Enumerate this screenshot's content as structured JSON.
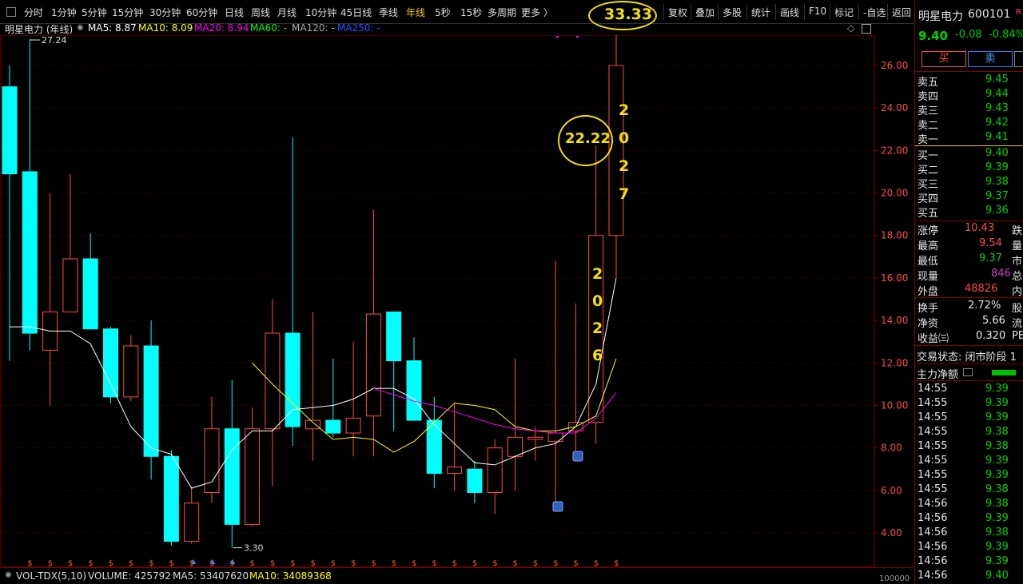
{
  "toolbar": {
    "periods": [
      "分时",
      "1分钟",
      "5分钟",
      "15分钟",
      "30分钟",
      "60分钟",
      "日线",
      "周线",
      "月线",
      "10分钟",
      "45日线",
      "季线",
      "年线",
      "5秒",
      "15秒",
      "多周期",
      "更多 〉"
    ],
    "active_period": "年线",
    "tools": [
      "复权",
      "叠加",
      "多股",
      "统计",
      "画线",
      "F10",
      "标记",
      "-自选",
      "返回"
    ]
  },
  "chart_header": {
    "stock_label": "明星电力 (年线)",
    "ma5": "MA5: 8.87",
    "ma10": "MA10: 8.09",
    "ma20": "MA20: 8.94",
    "ma60": "MA60: -",
    "ma120": "MA120: -",
    "ma250": "MA250: -"
  },
  "colors": {
    "up": "#ff4a4a",
    "down": "#00ffff",
    "ma5": "#ffffff",
    "ma10": "#ffff00",
    "ma20": "#ff00ff",
    "ma60": "#00ff00",
    "ma120": "#aaaaaa",
    "ma250": "#3050ff",
    "annotation": "#f5e100"
  },
  "chart_data": {
    "type": "candlestick",
    "title": "明星电力 (年线)",
    "ylim": [
      3,
      28.5
    ],
    "y_ticks": [
      "26.00",
      "24.00",
      "22.00",
      "20.00",
      "18.00",
      "16.00",
      "14.00",
      "12.00",
      "10.00",
      "8.00",
      "6.00",
      "4.00"
    ],
    "y_tick_values": [
      26,
      24,
      22,
      20,
      18,
      16,
      14,
      12,
      10,
      8,
      6,
      4
    ],
    "annotations": {
      "max_label": "27.24",
      "min_label": "3.30"
    },
    "candles": [
      {
        "o": 25.0,
        "h": 26.0,
        "l": 12.1,
        "c": 20.9
      },
      {
        "o": 21.0,
        "h": 27.24,
        "l": 12.6,
        "c": 13.4
      },
      {
        "o": 12.6,
        "h": 20.0,
        "l": 10.0,
        "c": 14.4
      },
      {
        "o": 14.4,
        "h": 20.9,
        "l": 14.4,
        "c": 16.9
      },
      {
        "o": 16.9,
        "h": 18.1,
        "l": 13.7,
        "c": 13.6
      },
      {
        "o": 13.6,
        "h": 13.7,
        "l": 10.1,
        "c": 10.4
      },
      {
        "o": 10.4,
        "h": 13.3,
        "l": 10.2,
        "c": 12.8
      },
      {
        "o": 12.8,
        "h": 14.0,
        "l": 6.5,
        "c": 7.6
      },
      {
        "o": 7.6,
        "h": 7.9,
        "l": 3.4,
        "c": 3.6
      },
      {
        "o": 3.6,
        "h": 6.2,
        "l": 3.5,
        "c": 5.4
      },
      {
        "o": 5.9,
        "h": 10.4,
        "l": 5.4,
        "c": 8.9
      },
      {
        "o": 8.9,
        "h": 11.2,
        "l": 3.3,
        "c": 4.4
      },
      {
        "o": 4.4,
        "h": 9.9,
        "l": 4.3,
        "c": 8.9
      },
      {
        "o": 8.9,
        "h": 15.0,
        "l": 6.2,
        "c": 13.4
      },
      {
        "o": 13.4,
        "h": 22.6,
        "l": 8.1,
        "c": 9.0
      },
      {
        "o": 8.9,
        "h": 14.4,
        "l": 7.4,
        "c": 9.3
      },
      {
        "o": 9.3,
        "h": 12.2,
        "l": 8.5,
        "c": 8.7
      },
      {
        "o": 8.7,
        "h": 13.0,
        "l": 7.6,
        "c": 9.4
      },
      {
        "o": 9.5,
        "h": 19.2,
        "l": 7.6,
        "c": 14.3
      },
      {
        "o": 14.4,
        "h": 14.4,
        "l": 8.8,
        "c": 12.1
      },
      {
        "o": 12.1,
        "h": 13.2,
        "l": 9.8,
        "c": 9.3
      },
      {
        "o": 9.3,
        "h": 10.4,
        "l": 6.1,
        "c": 6.8
      },
      {
        "o": 6.8,
        "h": 10.1,
        "l": 6.0,
        "c": 7.1
      },
      {
        "o": 7.0,
        "h": 7.4,
        "l": 5.4,
        "c": 5.9
      },
      {
        "o": 5.9,
        "h": 8.4,
        "l": 4.9,
        "c": 8.0
      },
      {
        "o": 7.6,
        "h": 12.2,
        "l": 6.0,
        "c": 8.5
      },
      {
        "o": 8.4,
        "h": 9.0,
        "l": 7.4,
        "c": 8.5
      },
      {
        "o": 8.3,
        "h": 16.8,
        "l": 5.4,
        "c": 8.7
      },
      {
        "o": 8.8,
        "h": 14.8,
        "l": 7.7,
        "c": 9.2
      },
      {
        "o": 9.2,
        "h": 22.22,
        "l": 8.2,
        "c": 18.0
      },
      {
        "o": 18.0,
        "h": 33.33,
        "l": 16.0,
        "c": 26.0
      }
    ],
    "ma5_values": [
      13.7,
      13.7,
      13.5,
      13.5,
      12.9,
      11.0,
      9.0,
      8.0,
      7.7,
      6.1,
      6.4,
      7.9,
      8.8,
      8.8,
      9.8,
      9.9,
      10.0,
      10.3,
      10.8,
      10.8,
      10.3,
      9.1,
      8.2,
      7.3,
      7.2,
      7.6,
      8.0,
      8.2,
      9.0,
      11.0,
      16.0
    ],
    "ma10_values": [
      12.0,
      11.0,
      10.1,
      9.2,
      8.4,
      8.5,
      8.4,
      7.8,
      8.3,
      9.2,
      10.1,
      10.0,
      9.8,
      9.0,
      8.8,
      8.8,
      9.0,
      9.5,
      12.2
    ],
    "ma20_values": [
      10.8,
      10.5,
      10.2,
      10.0,
      9.7,
      9.4,
      9.1,
      8.9,
      8.8,
      8.7,
      8.7,
      9.4,
      10.6
    ],
    "overlays": {
      "year_2026_label": [
        "2",
        "0",
        "2",
        "6"
      ],
      "year_2027_label": [
        "2",
        "0",
        "2",
        "7"
      ],
      "circle_22": "22.22",
      "circle_33": "33.33"
    }
  },
  "volume_bar": {
    "label": "VOL-TDX(5,10)",
    "volume": "VOLUME: 425792",
    "ma5": "MA5: 53407620",
    "ma10": "MA10: 34089368",
    "axis_label": "100000"
  },
  "quote": {
    "name": "明星电力",
    "code": "600101",
    "flag": "R",
    "price": "9.40",
    "change": "-0.08",
    "change_pct": "-0.84%",
    "buy_btn": "买",
    "sell_btn": "卖",
    "asks": [
      {
        "label": "卖五",
        "price": "9.45"
      },
      {
        "label": "卖四",
        "price": "9.44"
      },
      {
        "label": "卖三",
        "price": "9.43"
      },
      {
        "label": "卖二",
        "price": "9.42"
      },
      {
        "label": "卖一",
        "price": "9.41"
      }
    ],
    "bids": [
      {
        "label": "买一",
        "price": "9.40"
      },
      {
        "label": "买二",
        "price": "9.39"
      },
      {
        "label": "买三",
        "price": "9.38"
      },
      {
        "label": "买四",
        "price": "9.37"
      },
      {
        "label": "买五",
        "price": "9.36"
      }
    ],
    "stats": [
      {
        "label": "涨停",
        "value": "10.43",
        "tail": "跌"
      },
      {
        "label": "最高",
        "value": "9.54",
        "tail": "量"
      },
      {
        "label": "最低",
        "value": "9.37",
        "tail": "市"
      },
      {
        "label": "现量",
        "value": "846",
        "tail": "总"
      },
      {
        "label": "外盘",
        "value": "48826",
        "tail": "内"
      }
    ],
    "stats2": [
      {
        "label": "换手",
        "value": "2.72%",
        "tail": "股"
      },
      {
        "label": "净资",
        "value": "5.66",
        "tail": "流"
      },
      {
        "label": "收益㈢",
        "value": "0.320",
        "tail": "PE"
      }
    ],
    "trade_state": "交易状态: 闭市阶段 1",
    "main_flow": "主力净额",
    "ticks": [
      {
        "time": "14:55",
        "price": "9.39"
      },
      {
        "time": "14:55",
        "price": "9.39"
      },
      {
        "time": "14:55",
        "price": "9.39"
      },
      {
        "time": "14:55",
        "price": "9.38"
      },
      {
        "time": "14:55",
        "price": "9.38"
      },
      {
        "time": "14:55",
        "price": "9.39"
      },
      {
        "time": "14:55",
        "price": "9.39"
      },
      {
        "time": "14:55",
        "price": "9.38"
      },
      {
        "time": "14:56",
        "price": "9.38"
      },
      {
        "time": "14:56",
        "price": "9.39"
      },
      {
        "time": "14:56",
        "price": "9.38"
      },
      {
        "time": "14:56",
        "price": "9.39"
      },
      {
        "time": "14:56",
        "price": "9.39"
      },
      {
        "time": "14:56",
        "price": "9.40"
      }
    ]
  }
}
